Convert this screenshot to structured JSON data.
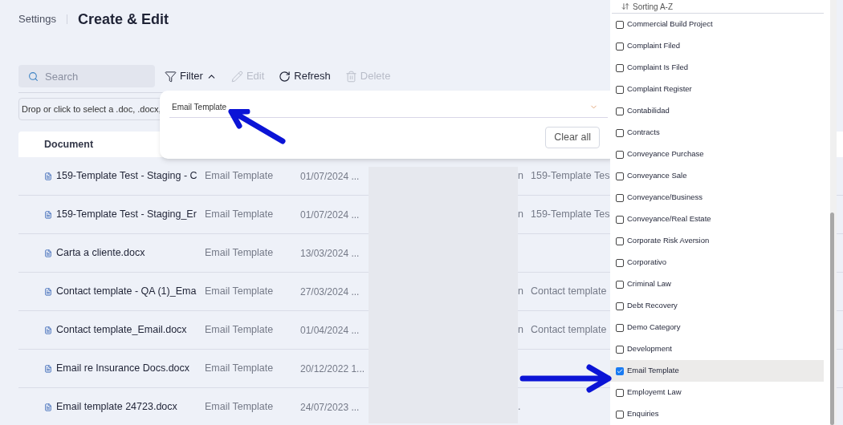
{
  "breadcrumb": {
    "parent": "Settings",
    "title": "Create & Edit"
  },
  "toolbar": {
    "search_placeholder": "Search",
    "buttons": [
      {
        "kind": "filter",
        "label": "Filter",
        "disabled": false
      },
      {
        "kind": "edit",
        "label": "Edit",
        "disabled": true
      },
      {
        "kind": "refresh",
        "label": "Refresh",
        "disabled": false
      },
      {
        "kind": "delete",
        "label": "Delete",
        "disabled": true
      }
    ]
  },
  "dropzone": {
    "text": "Drop or click to select a .doc, .docx,"
  },
  "table": {
    "columns": [
      "Document"
    ],
    "rows": [
      {
        "document": "159-Template Test - Staging - C",
        "category": "Email Template",
        "date": "01/07/2024 ...",
        "column_4": "n",
        "column_5": "159-Template Tes"
      },
      {
        "document": "159-Template Test - Staging_Er",
        "category": "Email Template",
        "date": "01/07/2024 ...",
        "column_4": "n",
        "column_5": "159-Template Tes"
      },
      {
        "document": "Carta a cliente.docx",
        "category": "Email Template",
        "date": "13/03/2024 ..."
      },
      {
        "document": "Contact template - QA (1)_Ema",
        "category": "Email Template",
        "date": "27/03/2024 ...",
        "column_4": "n",
        "column_5": "Contact template"
      },
      {
        "document": "Contact template_Email.docx",
        "category": "Email Template",
        "date": "01/04/2024 ...",
        "column_4": "n",
        "column_5": "Contact template"
      },
      {
        "document": "Email re Insurance Docs.docx",
        "category": "Email Template",
        "date": "20/12/2022 1..."
      },
      {
        "document": "Email template 24723.docx",
        "category": "Email Template",
        "date": "24/07/2023 ...",
        "column_4": "."
      }
    ]
  },
  "filter_popup": {
    "value": "Email Template",
    "clear_label": "Clear all"
  },
  "category_menu": {
    "sorting": "Sorting A-Z",
    "items": [
      {
        "label": "Commercial Build Project",
        "checked": false,
        "selected": false
      },
      {
        "label": "Complaint Filed",
        "checked": false,
        "selected": false
      },
      {
        "label": "Complaint Is Filed",
        "checked": false,
        "selected": false
      },
      {
        "label": "Complaint Register",
        "checked": false,
        "selected": false
      },
      {
        "label": "Contabilidad",
        "checked": false,
        "selected": false
      },
      {
        "label": "Contracts",
        "checked": false,
        "selected": false
      },
      {
        "label": "Conveyance Purchase",
        "checked": false,
        "selected": false
      },
      {
        "label": "Conveyance Sale",
        "checked": false,
        "selected": false
      },
      {
        "label": "Conveyance/Business",
        "checked": false,
        "selected": false
      },
      {
        "label": "Conveyance/Real Estate",
        "checked": false,
        "selected": false
      },
      {
        "label": "Corporate Risk Aversion",
        "checked": false,
        "selected": false
      },
      {
        "label": "Corporativo",
        "checked": false,
        "selected": false
      },
      {
        "label": "Criminal Law",
        "checked": false,
        "selected": false
      },
      {
        "label": "Debt Recovery",
        "checked": false,
        "selected": false
      },
      {
        "label": "Demo Category",
        "checked": false,
        "selected": false
      },
      {
        "label": "Development",
        "checked": false,
        "selected": false
      },
      {
        "label": "Email Template",
        "checked": true,
        "selected": true
      },
      {
        "label": "Employemt Law",
        "checked": false,
        "selected": false
      },
      {
        "label": "Enquiries",
        "checked": false,
        "selected": false
      }
    ]
  }
}
